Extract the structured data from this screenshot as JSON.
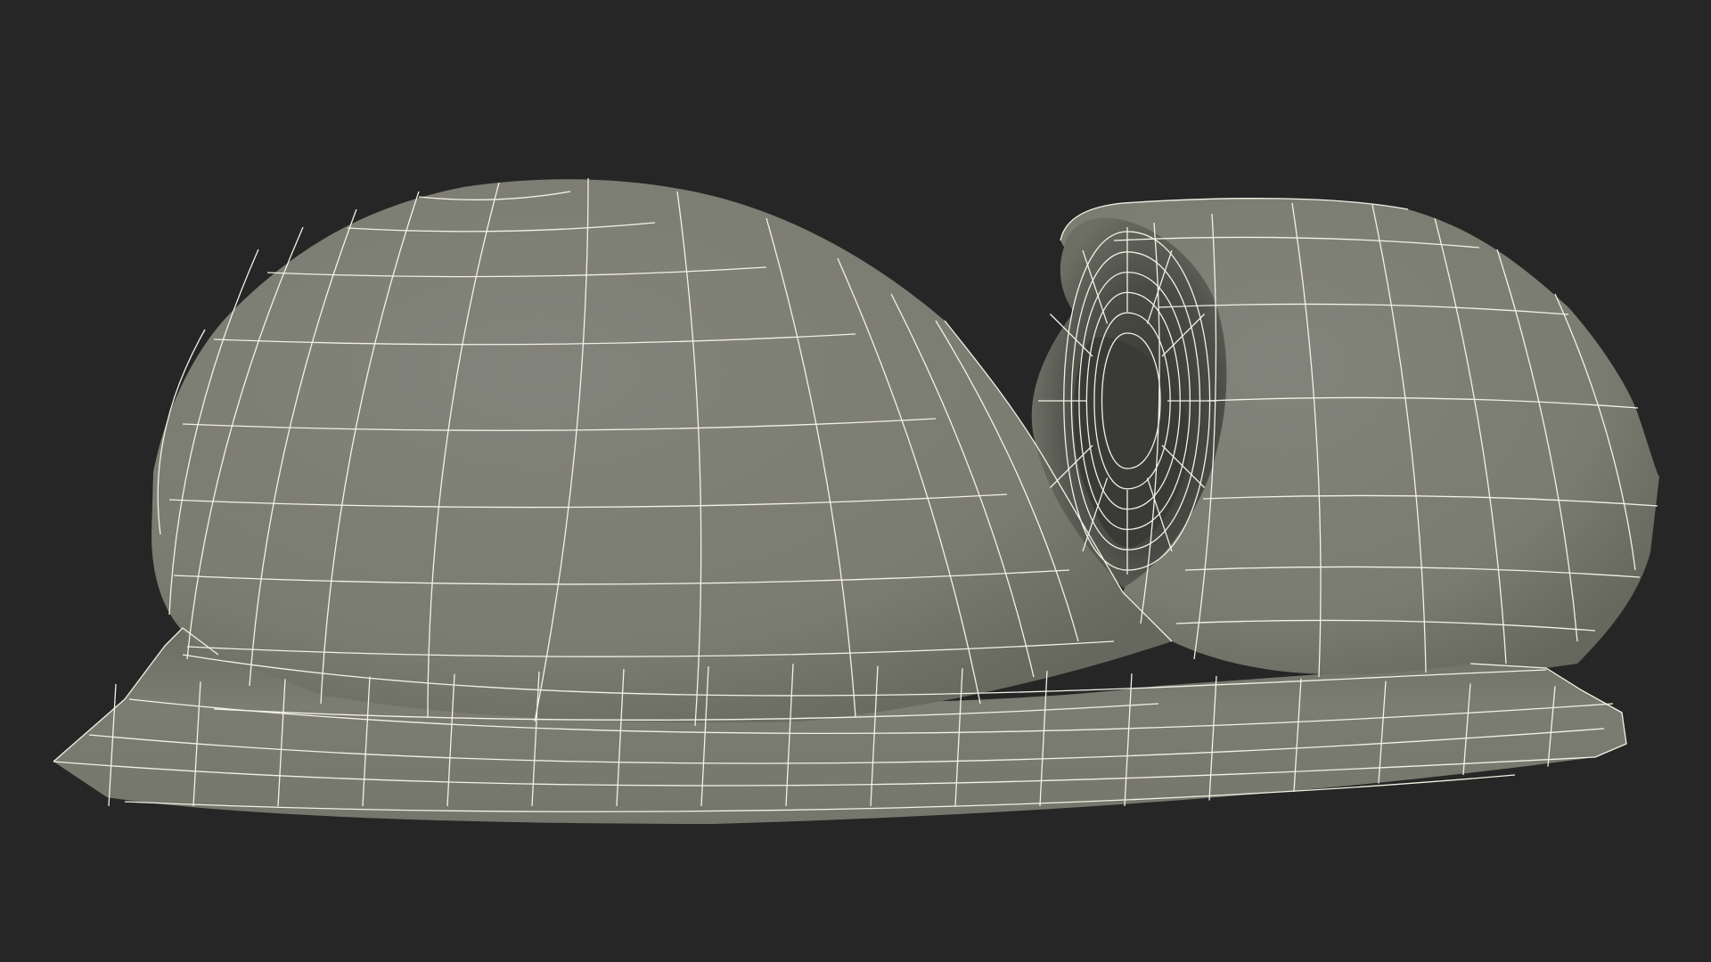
{
  "viewport": {
    "background_color": "#262626",
    "render_mode": "wireframe-on-shaded",
    "object": {
      "description_icon": "3d-mesh-object",
      "surface_color": "#7b7c70",
      "surface_shadow_color": "#5f6057",
      "cavity_color": "#44453f",
      "wire_color": "#f4f1e6"
    }
  }
}
